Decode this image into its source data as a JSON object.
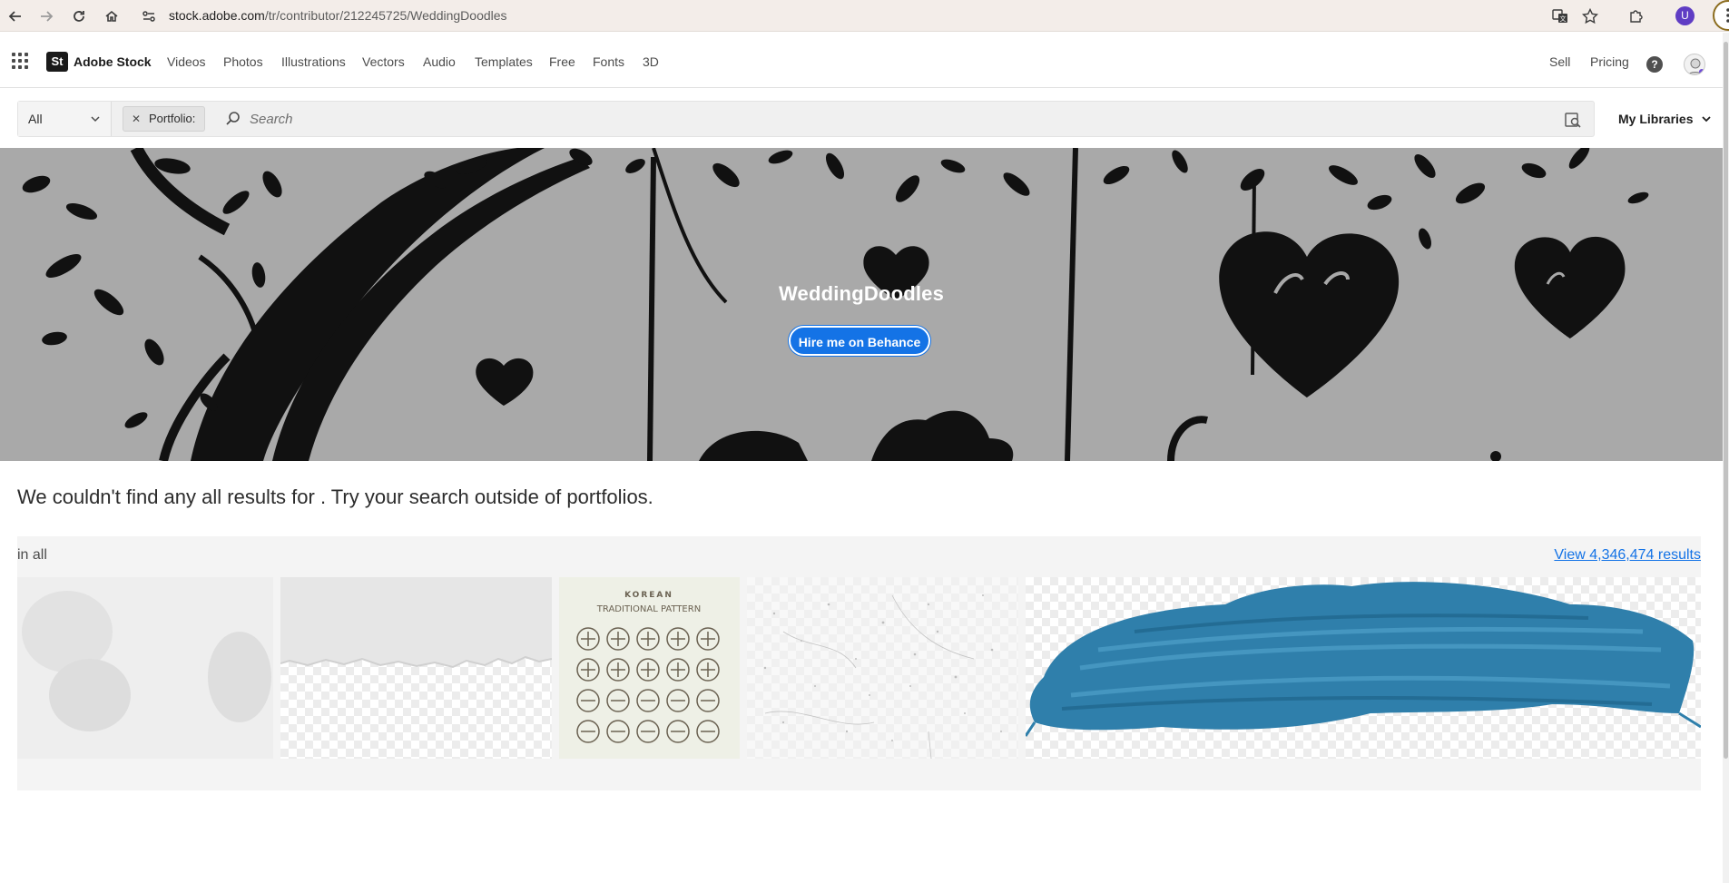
{
  "browser": {
    "url_host": "stock.adobe.com",
    "url_path": "/tr/contributor/212245725/WeddingDoodles",
    "profile_initial": "U"
  },
  "header": {
    "brand_logo": "St",
    "brand_name": "Adobe Stock",
    "nav": [
      "Videos",
      "Photos",
      "Illustrations",
      "Vectors",
      "Audio",
      "Templates",
      "Free",
      "Fonts",
      "3D"
    ],
    "sell": "Sell",
    "pricing": "Pricing",
    "help": "?"
  },
  "search": {
    "scope": "All",
    "filter_tag": "Portfolio:",
    "placeholder": "Search",
    "my_libraries": "My Libraries"
  },
  "hero": {
    "title": "WeddingDoodles",
    "button": "Hire me on Behance"
  },
  "results": {
    "message": "We couldn't find any all results for . Try your search outside of portfolios.",
    "section_label": "in all",
    "view_link": "View 4,346,474 results",
    "pattern_heading": "KOREAN",
    "pattern_subheading": "TRADITIONAL PATTERN"
  },
  "colors": {
    "accent": "#1473e6",
    "hero_bg": "#a9a9a9",
    "brush": "#2f7fab"
  }
}
